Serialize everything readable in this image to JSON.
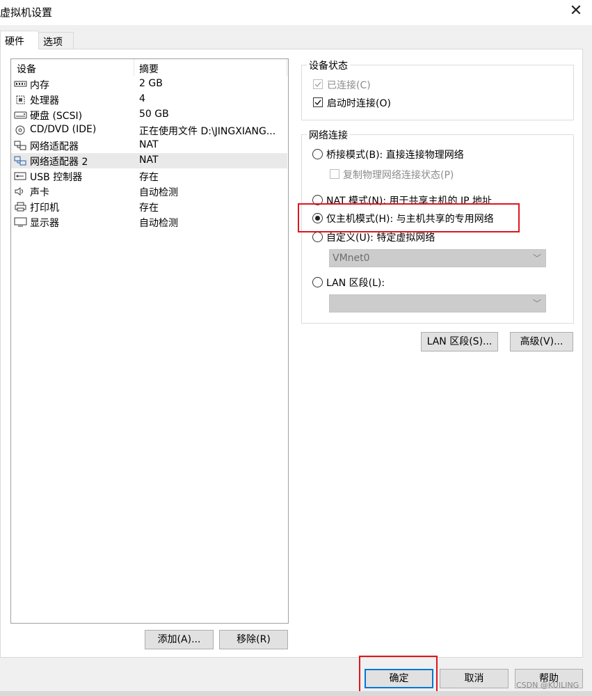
{
  "window": {
    "title": "虚拟机设置"
  },
  "tabs": [
    {
      "label": "硬件"
    },
    {
      "label": "选项"
    }
  ],
  "device_table": {
    "headers": {
      "device": "设备",
      "summary": "摘要"
    },
    "rows": [
      {
        "icon": "memory-icon",
        "name": "内存",
        "value": "2 GB"
      },
      {
        "icon": "processor-icon",
        "name": "处理器",
        "value": "4"
      },
      {
        "icon": "hard-disk-icon",
        "name": "硬盘 (SCSI)",
        "value": "50 GB"
      },
      {
        "icon": "cd-dvd-icon",
        "name": "CD/DVD (IDE)",
        "value": "正在使用文件 D:\\JINGXIANG..."
      },
      {
        "icon": "network-adapter-icon",
        "name": "网络适配器",
        "value": "NAT"
      },
      {
        "icon": "network-adapter-icon",
        "name": "网络适配器 2",
        "value": "NAT"
      },
      {
        "icon": "usb-icon",
        "name": "USB 控制器",
        "value": "存在"
      },
      {
        "icon": "sound-card-icon",
        "name": "声卡",
        "value": "自动检测"
      },
      {
        "icon": "printer-icon",
        "name": "打印机",
        "value": "存在"
      },
      {
        "icon": "display-icon",
        "name": "显示器",
        "value": "自动检测"
      }
    ],
    "selected_index": 5
  },
  "device_buttons": {
    "add": "添加(A)...",
    "remove": "移除(R)"
  },
  "device_status": {
    "title": "设备状态",
    "connected": {
      "label": "已连接(C)",
      "checked": true,
      "disabled": true
    },
    "connect_at_power_on": {
      "label": "启动时连接(O)",
      "checked": true
    }
  },
  "network_connection": {
    "title": "网络连接",
    "bridged": "桥接模式(B): 直接连接物理网络",
    "replicate": "复制物理网络连接状态(P)",
    "nat": "NAT 模式(N): 用于共享主机的 IP 地址",
    "host_only": "仅主机模式(H): 与主机共享的专用网络",
    "custom": "自定义(U): 特定虚拟网络",
    "custom_value": "VMnet0",
    "lan_segment": "LAN 区段(L):",
    "lan_value": "",
    "selected": "host_only"
  },
  "network_buttons": {
    "lan_segments": "LAN 区段(S)...",
    "advanced": "高级(V)..."
  },
  "dialog_buttons": {
    "ok": "确定",
    "cancel": "取消",
    "help": "帮助"
  },
  "watermark": "CSDN @KUILING",
  "colors": {
    "highlight_red": "#e0141b",
    "focus_blue": "#0078d7"
  }
}
